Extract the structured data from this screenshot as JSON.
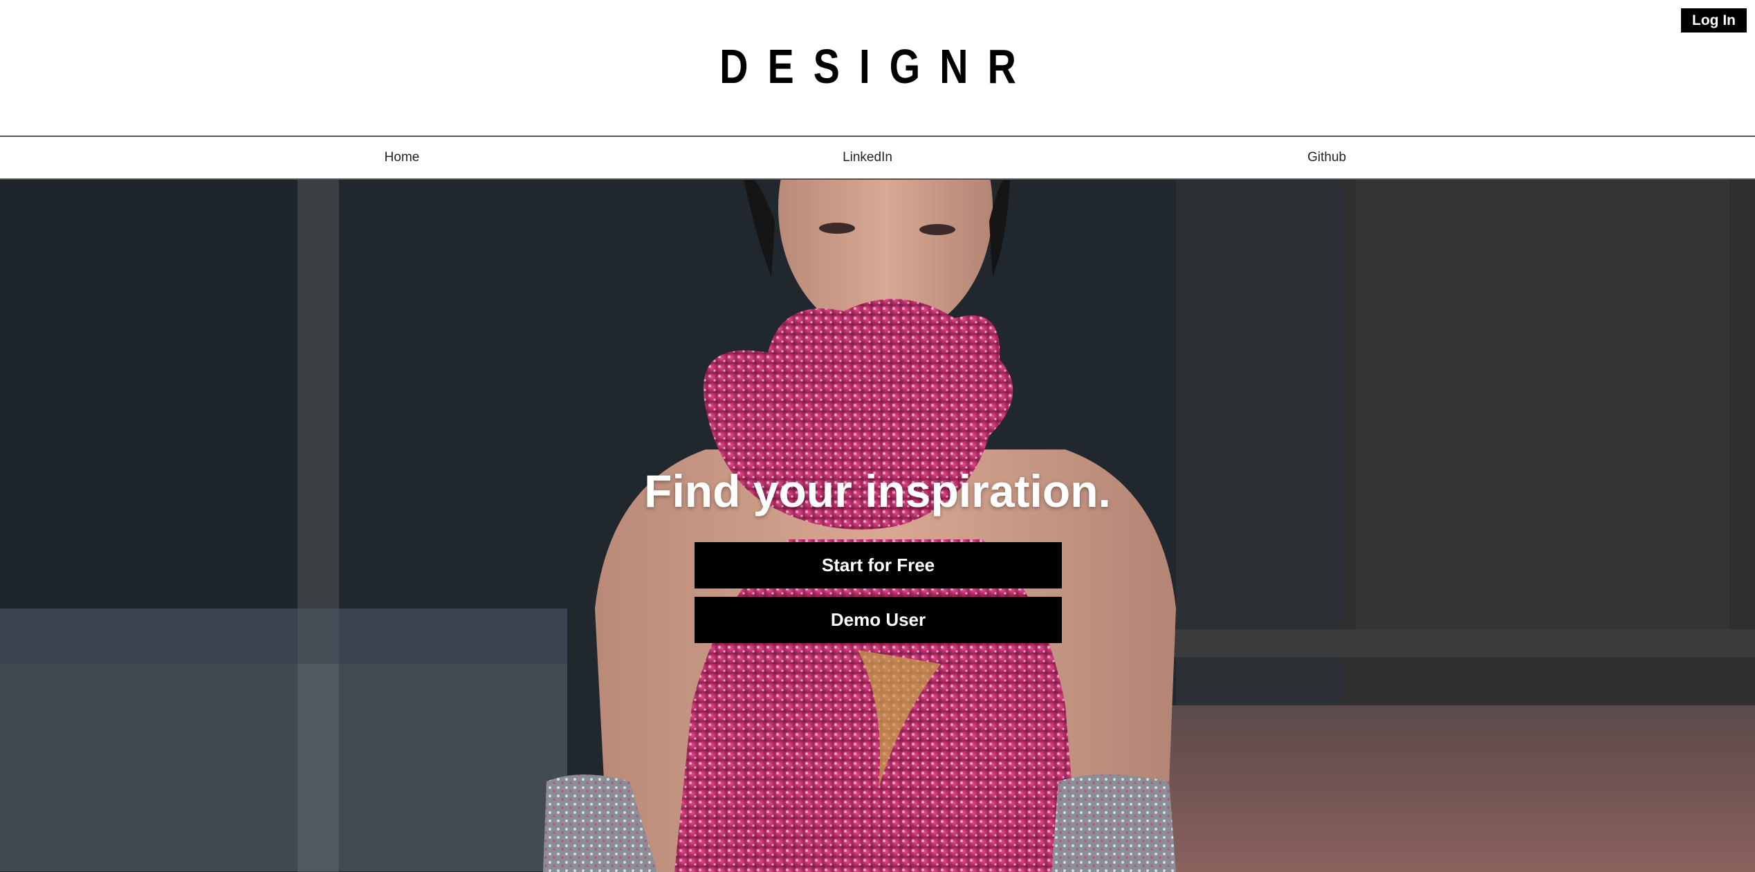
{
  "header": {
    "logo": "DESIGNR",
    "login_label": "Log In"
  },
  "nav": {
    "items": [
      {
        "label": "Home"
      },
      {
        "label": "LinkedIn"
      },
      {
        "label": "Github"
      }
    ]
  },
  "hero": {
    "image_description": "runway model in pink sequined halter dress",
    "title": "Find your inspiration.",
    "start_label": "Start for Free",
    "demo_label": "Demo User"
  },
  "colors": {
    "button_bg": "#000000",
    "button_text": "#ffffff",
    "nav_border": "#555555",
    "dress_pink": "#c2336f"
  }
}
